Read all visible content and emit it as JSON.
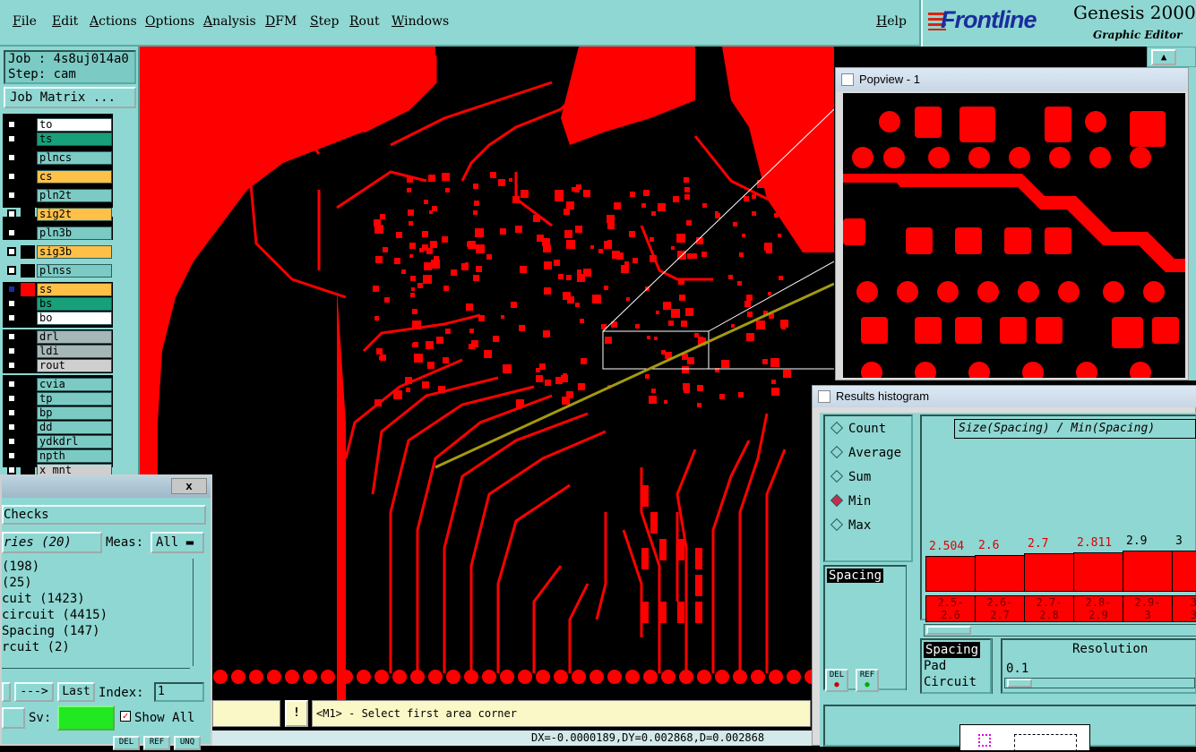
{
  "menu": [
    "File",
    "Edit",
    "Actions",
    "Options",
    "Analysis",
    "DFM",
    "Step",
    "Rout",
    "Windows"
  ],
  "help": "Help",
  "brand": {
    "logo": "Frontline",
    "product": "Genesis 2000",
    "subtitle": "Graphic Editor"
  },
  "left": {
    "job": "Job : 4s8uj014a0",
    "step": "Step: cam",
    "job_matrix": "Job Matrix ...",
    "layers": [
      {
        "name": "to",
        "color": "#ffffff"
      },
      {
        "name": "ts",
        "color": "#17a079"
      },
      {
        "name": "plncs",
        "color": "#7ccac4"
      },
      {
        "name": "cs",
        "color": "#ffc048"
      },
      {
        "name": "pln2t",
        "color": "#7ccac4"
      },
      {
        "name": "sig2t",
        "color": "#ffc048"
      },
      {
        "name": "pln3b",
        "color": "#7ccac4"
      },
      {
        "name": "sig3b",
        "color": "#ffc048"
      },
      {
        "name": "plnss",
        "color": "#7ccac4"
      },
      {
        "name": "ss",
        "color": "#ffc048"
      },
      {
        "name": "bs",
        "color": "#17a079"
      },
      {
        "name": "bo",
        "color": "#ffffff"
      },
      {
        "name": "drl",
        "color": "#a6b7b7"
      },
      {
        "name": "ldi",
        "color": "#a6b7b7"
      },
      {
        "name": "rout",
        "color": "#cfcfcf"
      },
      {
        "name": "cvia",
        "color": "#7ccac4"
      },
      {
        "name": "tp",
        "color": "#7ccac4"
      },
      {
        "name": "bp",
        "color": "#7ccac4"
      },
      {
        "name": "dd",
        "color": "#7ccac4"
      },
      {
        "name": "ydkdrl",
        "color": "#7ccac4"
      },
      {
        "name": "npth",
        "color": "#7ccac4"
      },
      {
        "name": "x_mnt",
        "color": "#cfcfcf"
      }
    ]
  },
  "checks": {
    "close": "x",
    "title": "Checks",
    "categories": "ries (20)",
    "meas_label": "Meas:",
    "meas_value": "All",
    "items": [
      "(198)",
      "(25)",
      "cuit (1423)",
      "circuit (4415)",
      "Spacing (147)",
      "rcuit (2)"
    ],
    "next": "--->",
    "last": "Last",
    "index_label": "Index:",
    "index_value": "1",
    "sv_label": "Sv:",
    "show_all": "Show All",
    "buttons": [
      "DEL",
      "REF",
      "UNQ"
    ]
  },
  "popview": {
    "title": "Popview - 1"
  },
  "histogram": {
    "title": "Results histogram",
    "modes": [
      "Count",
      "Average",
      "Sum",
      "Min",
      "Max"
    ],
    "selected_mode": "Min",
    "list1": [
      "Spacing"
    ],
    "header": "Size(Spacing) / Min(Spacing)",
    "bars": [
      {
        "value": "2.504",
        "bin": [
          "2.5-",
          "2.6"
        ],
        "level": 0.4
      },
      {
        "value": "2.6",
        "bin": [
          "2.6-",
          "2.7"
        ],
        "level": 0.41
      },
      {
        "value": "2.7",
        "bin": [
          "2.7-",
          "2.8"
        ],
        "level": 0.43
      },
      {
        "value": "2.811",
        "bin": [
          "2.8-",
          "2.9"
        ],
        "level": 0.44
      },
      {
        "value": "2.9",
        "bin": [
          "2.9-",
          "3"
        ],
        "level": 0.46
      },
      {
        "value": "3",
        "bin": [
          "3-",
          "3."
        ],
        "level": 0.46
      }
    ],
    "list2": [
      "Spacing",
      "Pad",
      "Circuit"
    ],
    "resolution_label": "Resolution",
    "resolution_value": "0.1",
    "del": "DEL",
    "ref": "REF"
  },
  "prompt": "<M1> - Select first area corner",
  "prompt_icon": "!",
  "status": "DX=-0.0000189,DY=0.002868,D=0.002868"
}
